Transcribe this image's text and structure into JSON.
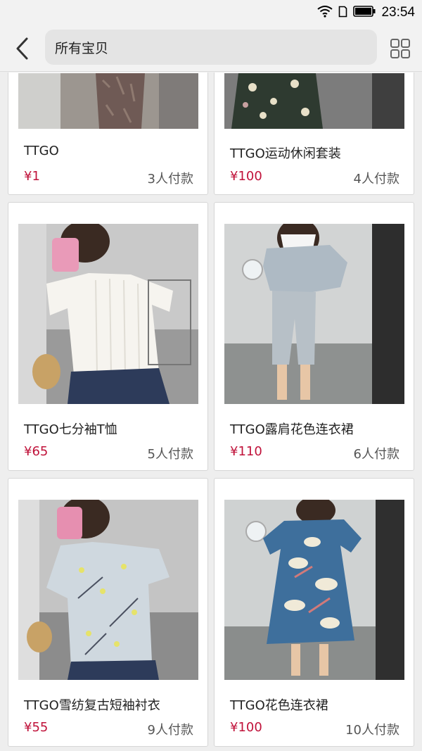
{
  "status_bar": {
    "time": "23:54"
  },
  "header": {
    "search_text": "所有宝贝"
  },
  "products": [
    {
      "title": "TTGO",
      "price": "¥1",
      "sold": "3人付款"
    },
    {
      "title": "TTGO运动休闲套装",
      "price": "¥100",
      "sold": "4人付款"
    },
    {
      "title": "TTGO七分袖T恤",
      "price": "¥65",
      "sold": "5人付款"
    },
    {
      "title": "TTGO露肩花色连衣裙",
      "price": "¥110",
      "sold": "6人付款"
    },
    {
      "title": "TTGO雪纺复古短袖衬衣",
      "price": "¥55",
      "sold": "9人付款"
    },
    {
      "title": "TTGO花色连衣裙",
      "price": "¥100",
      "sold": "10人付款"
    }
  ]
}
